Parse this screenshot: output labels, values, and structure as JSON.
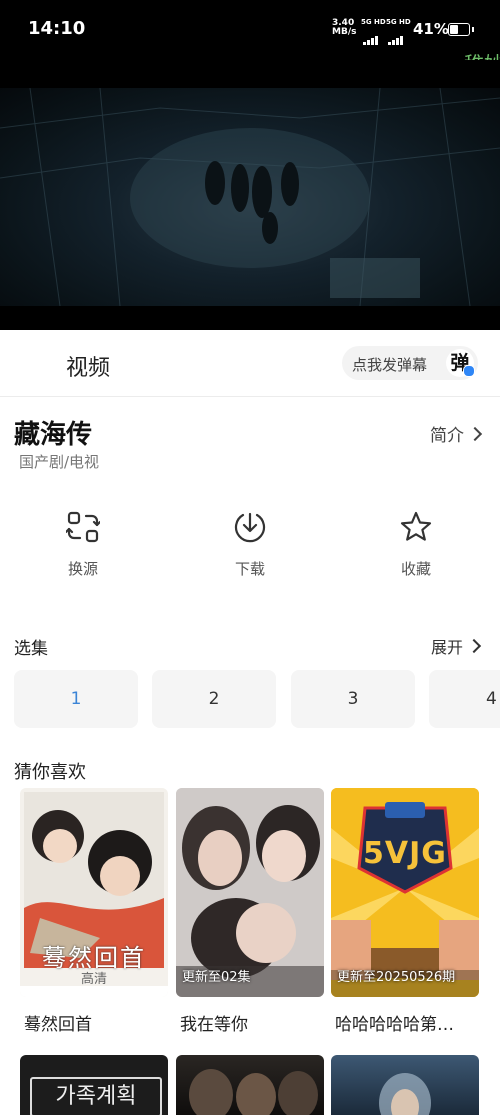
{
  "status_bar": {
    "time": "14:10",
    "speed_value": "3.40",
    "speed_unit": "MB/s",
    "net1": "5G HD",
    "net2": "5G HD",
    "battery": "41%"
  },
  "watermark": "稚妙",
  "header": {
    "title": "视频",
    "danmu_placeholder": "点我发弹幕",
    "danmu_badge": "弹"
  },
  "show": {
    "title": "藏海传",
    "meta": "国产剧/电视",
    "intro_label": "简介"
  },
  "actions": [
    {
      "label": "换源",
      "icon": "swap-source-icon"
    },
    {
      "label": "下载",
      "icon": "download-icon"
    },
    {
      "label": "收藏",
      "icon": "star-icon"
    }
  ],
  "episodes": {
    "title": "选集",
    "expand_label": "展开",
    "items": [
      "1",
      "2",
      "3",
      "4"
    ],
    "active": "1"
  },
  "recommendations": {
    "title": "猜你喜欢",
    "items": [
      {
        "name": "蓦然回首",
        "badge": "",
        "poster_text": "蓦然回首",
        "poster_sub": "高清"
      },
      {
        "name": "我在等你",
        "badge": "更新至02集",
        "poster_text": "",
        "poster_sub": ""
      },
      {
        "name": "哈哈哈哈哈第…",
        "badge": "更新至20250526期",
        "poster_text": "5VJG",
        "poster_sub": ""
      }
    ],
    "second_row_text": "가족계획"
  }
}
